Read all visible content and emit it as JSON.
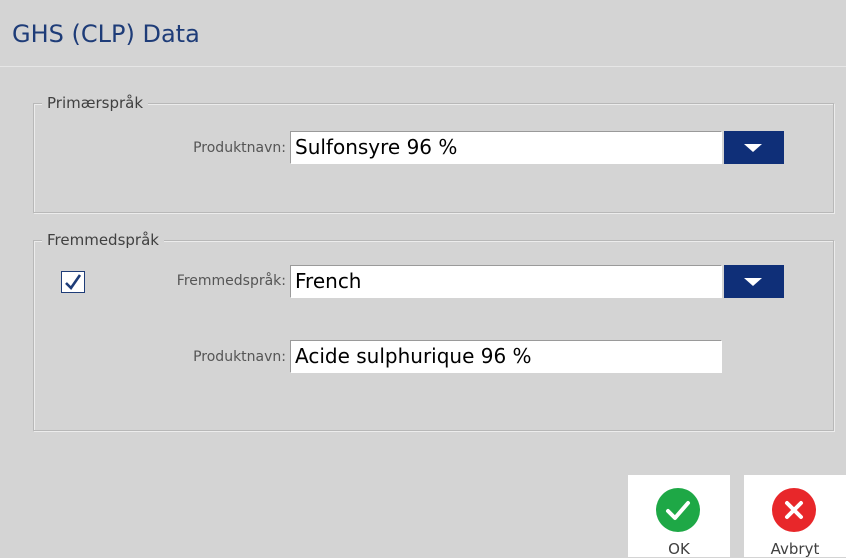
{
  "dialog": {
    "title": "GHS (CLP) Data"
  },
  "primary": {
    "legend": "Primærspråk",
    "product_label": "Produktnavn:",
    "product_value": "Sulfonsyre 96 %"
  },
  "foreign": {
    "legend": "Fremmedspråk",
    "checkbox_checked": true,
    "language_label": "Fremmedspråk:",
    "language_value": "French",
    "product_label": "Produktnavn:",
    "product_value": "Acide sulphurique 96 %"
  },
  "buttons": {
    "ok_label": "OK",
    "cancel_label": "Avbryt"
  },
  "icons": {
    "dropdown": "chevron-down-icon",
    "check": "check-icon",
    "ok": "check-circle-icon",
    "cancel": "x-circle-icon"
  },
  "colors": {
    "title": "#1e3c78",
    "dropdown_bg": "#0f2f78",
    "ok_green": "#1ea846",
    "cancel_red": "#e8272a"
  }
}
